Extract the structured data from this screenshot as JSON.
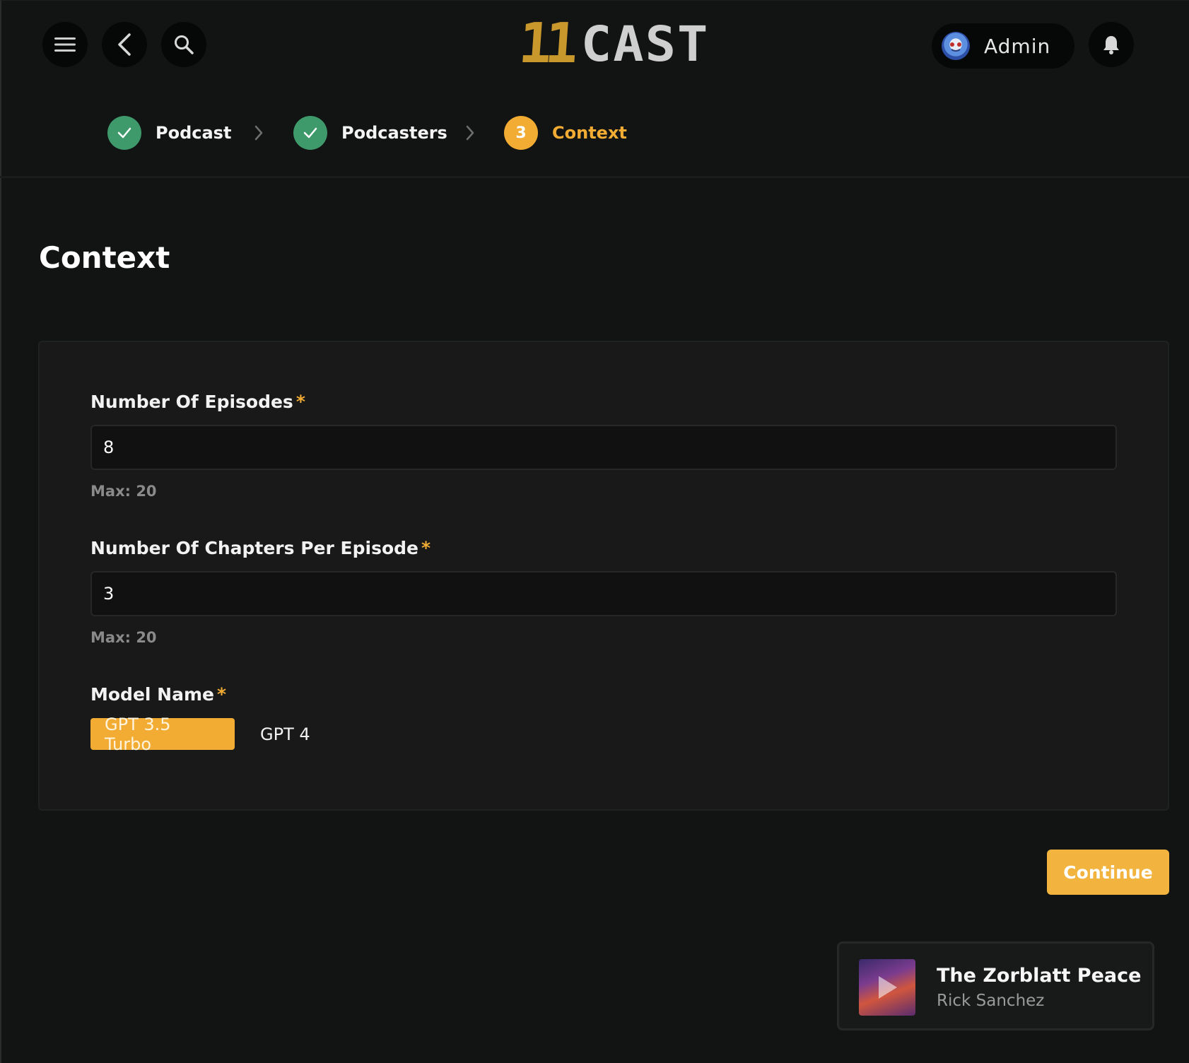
{
  "header": {
    "logo_number": "11",
    "logo_word": "CAST",
    "user_name": "Admin"
  },
  "stepper": [
    {
      "label": "Podcast",
      "state": "done"
    },
    {
      "label": "Podcasters",
      "state": "done"
    },
    {
      "label": "Context",
      "state": "active",
      "number": "3"
    }
  ],
  "page": {
    "title": "Context"
  },
  "form": {
    "episodes": {
      "label": "Number Of Episodes",
      "required_mark": "*",
      "value": "8",
      "hint": "Max: 20"
    },
    "chapters": {
      "label": "Number Of Chapters Per Episode",
      "required_mark": "*",
      "value": "3",
      "hint": "Max: 20"
    },
    "model": {
      "label": "Model Name",
      "required_mark": "*",
      "options": [
        "GPT 3.5 Turbo",
        "GPT 4"
      ],
      "selected": "GPT 3.5 Turbo"
    },
    "continue_label": "Continue"
  },
  "player": {
    "title": "The Zorblatt Peace Ac",
    "artist": "Rick Sanchez"
  },
  "colors": {
    "accent": "#f2ac33",
    "success": "#3f9a6b",
    "background": "#121413",
    "card": "#181918"
  },
  "icons": [
    "menu-icon",
    "back-chevron-icon",
    "search-icon",
    "bell-icon",
    "check-icon",
    "chevron-right-icon",
    "play-icon"
  ]
}
